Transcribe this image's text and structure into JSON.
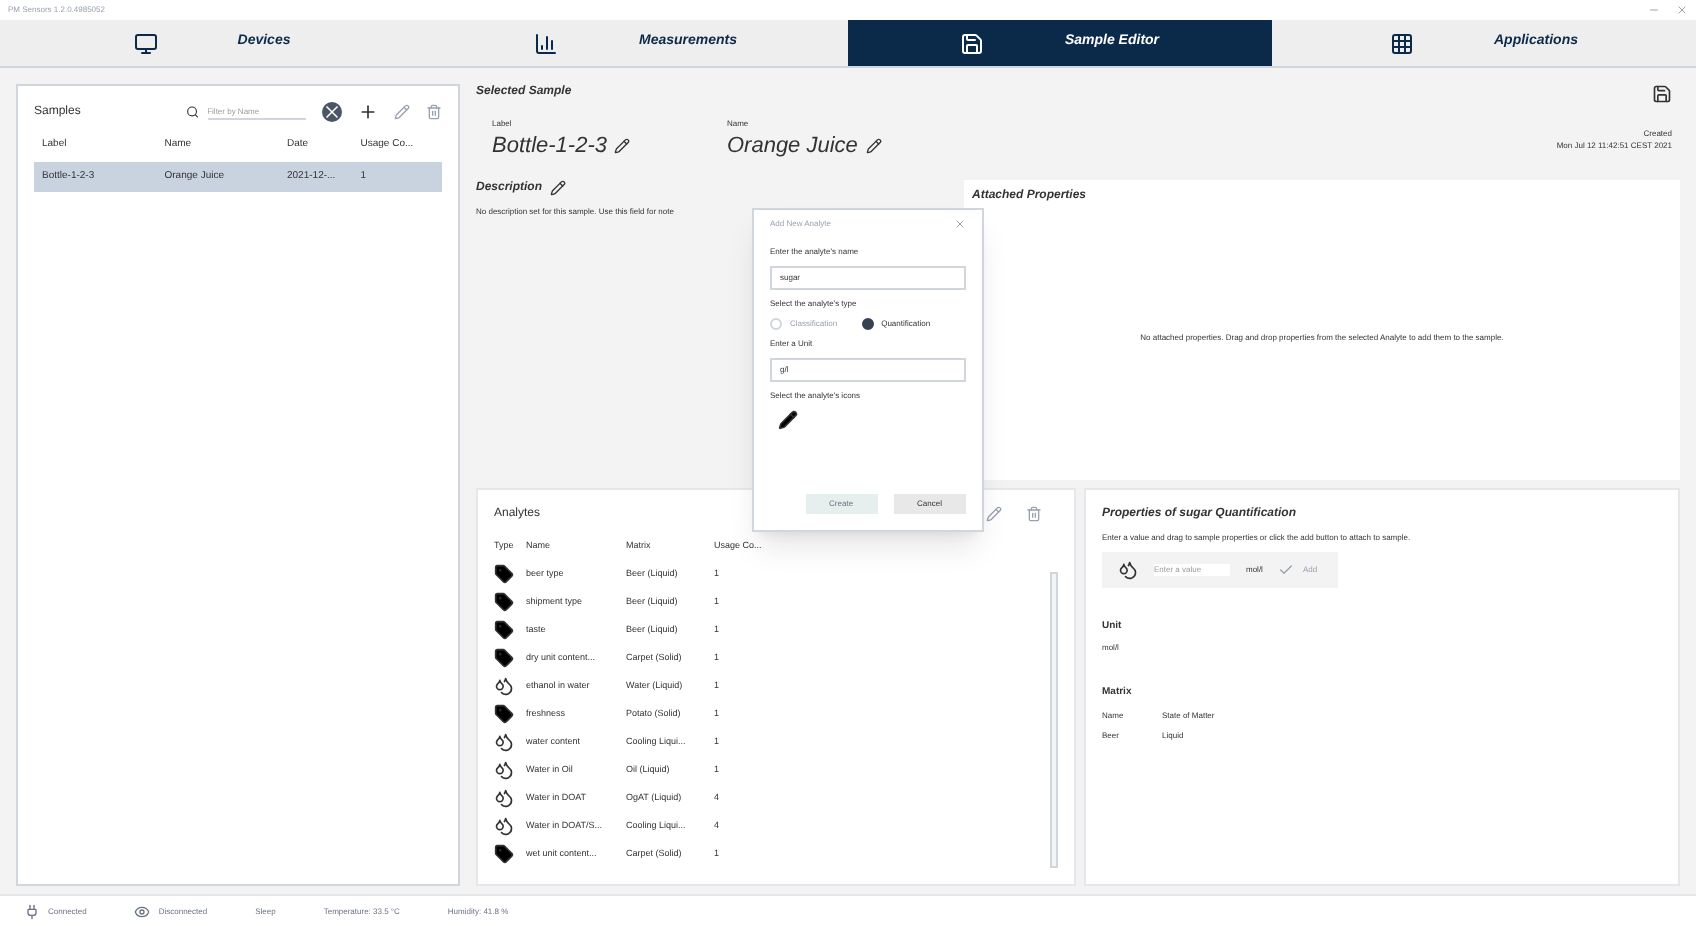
{
  "window": {
    "title": "PM Sensors 1.2.0.4985052"
  },
  "tabs": [
    {
      "label": "Devices",
      "selected": false
    },
    {
      "label": "Measurements",
      "selected": false
    },
    {
      "label": "Sample Editor",
      "selected": true
    },
    {
      "label": "Applications",
      "selected": false
    }
  ],
  "samples": {
    "title": "Samples",
    "search": {
      "placeholder": "Filter by Name"
    },
    "columns": [
      "Label",
      "Name",
      "Date",
      "Usage Co..."
    ],
    "rows": [
      {
        "cells": [
          "Bottle-1-2-3",
          "Orange Juice",
          "2021-12-...",
          "1"
        ],
        "selected": true
      }
    ]
  },
  "selected_sample": {
    "title": "Selected Sample",
    "label_caption": "Label",
    "label": "Bottle-1-2-3",
    "name_caption": "Name",
    "name": "Orange Juice",
    "created_caption": "Created",
    "created": "Mon Jul 12 11:42:51 CEST 2021"
  },
  "description": {
    "title": "Description",
    "text": "No description set for this sample. Use this field for note"
  },
  "attached": {
    "title": "Attached Properties",
    "empty_text": "No attached properties. Drag and drop properties from the selected Analyte to add them to the sample."
  },
  "dialog": {
    "title": "Add New Analyte",
    "name_label": "Enter the analyte's name",
    "name_value": "sugar",
    "type_label": "Select the analyte's type",
    "types": [
      {
        "label": "Classification",
        "selected": false
      },
      {
        "label": "Quantification",
        "selected": true
      }
    ],
    "unit_label": "Enter a Unit",
    "unit_value": "g/l",
    "icon_label": "Select the analyte's icons",
    "buttons": [
      {
        "label": "Create",
        "disabled": true
      },
      {
        "label": "Cancel",
        "disabled": false
      }
    ]
  },
  "analytes": {
    "title": "Analytes",
    "type_column": "Type",
    "columns": [
      "Name",
      "Matrix",
      "Usage Co..."
    ],
    "rows": [
      {
        "kind": "label",
        "cells": [
          "beer type",
          "Beer (Liquid)",
          "1"
        ]
      },
      {
        "kind": "label",
        "cells": [
          "shipment type",
          "Beer (Liquid)",
          "1"
        ]
      },
      {
        "kind": "label",
        "cells": [
          "taste",
          "Beer (Liquid)",
          "1"
        ]
      },
      {
        "kind": "label",
        "cells": [
          "dry unit content...",
          "Carpet (Solid)",
          "1"
        ]
      },
      {
        "kind": "drops",
        "cells": [
          "ethanol in water",
          "Water (Liquid)",
          "1"
        ]
      },
      {
        "kind": "label",
        "cells": [
          "freshness",
          "Potato (Solid)",
          "1"
        ]
      },
      {
        "kind": "drops",
        "cells": [
          "water content",
          "Cooling Liqui...",
          "1"
        ]
      },
      {
        "kind": "drops",
        "cells": [
          "Water in Oil",
          "Oil (Liquid)",
          "1"
        ]
      },
      {
        "kind": "drops",
        "cells": [
          "Water in DOAT",
          "OgAT (Liquid)",
          "4"
        ]
      },
      {
        "kind": "drops",
        "cells": [
          "Water in DOAT/S...",
          "Cooling Liqui...",
          "4"
        ]
      },
      {
        "kind": "label",
        "cells": [
          "wet unit content...",
          "Carpet (Solid)",
          "1"
        ]
      }
    ]
  },
  "properties": {
    "title": "Properties of sugar Quantification",
    "hint": "Enter a value and drag to sample properties or click the add button to attach to sample.",
    "value_placeholder": "Enter a value",
    "unit_chip": "mol/l",
    "add_label": "Add",
    "unit_heading": "Unit",
    "unit": "mol/l",
    "matrix_heading": "Matrix",
    "matrix": [
      [
        "Name",
        "State of Matter"
      ],
      [
        "Beer",
        "Liquid"
      ]
    ]
  },
  "status_bar": [
    "Connected",
    "Disconnected",
    "Sleep",
    "Temperature: 33.5 °C",
    "Humidity: 41.8 %"
  ]
}
